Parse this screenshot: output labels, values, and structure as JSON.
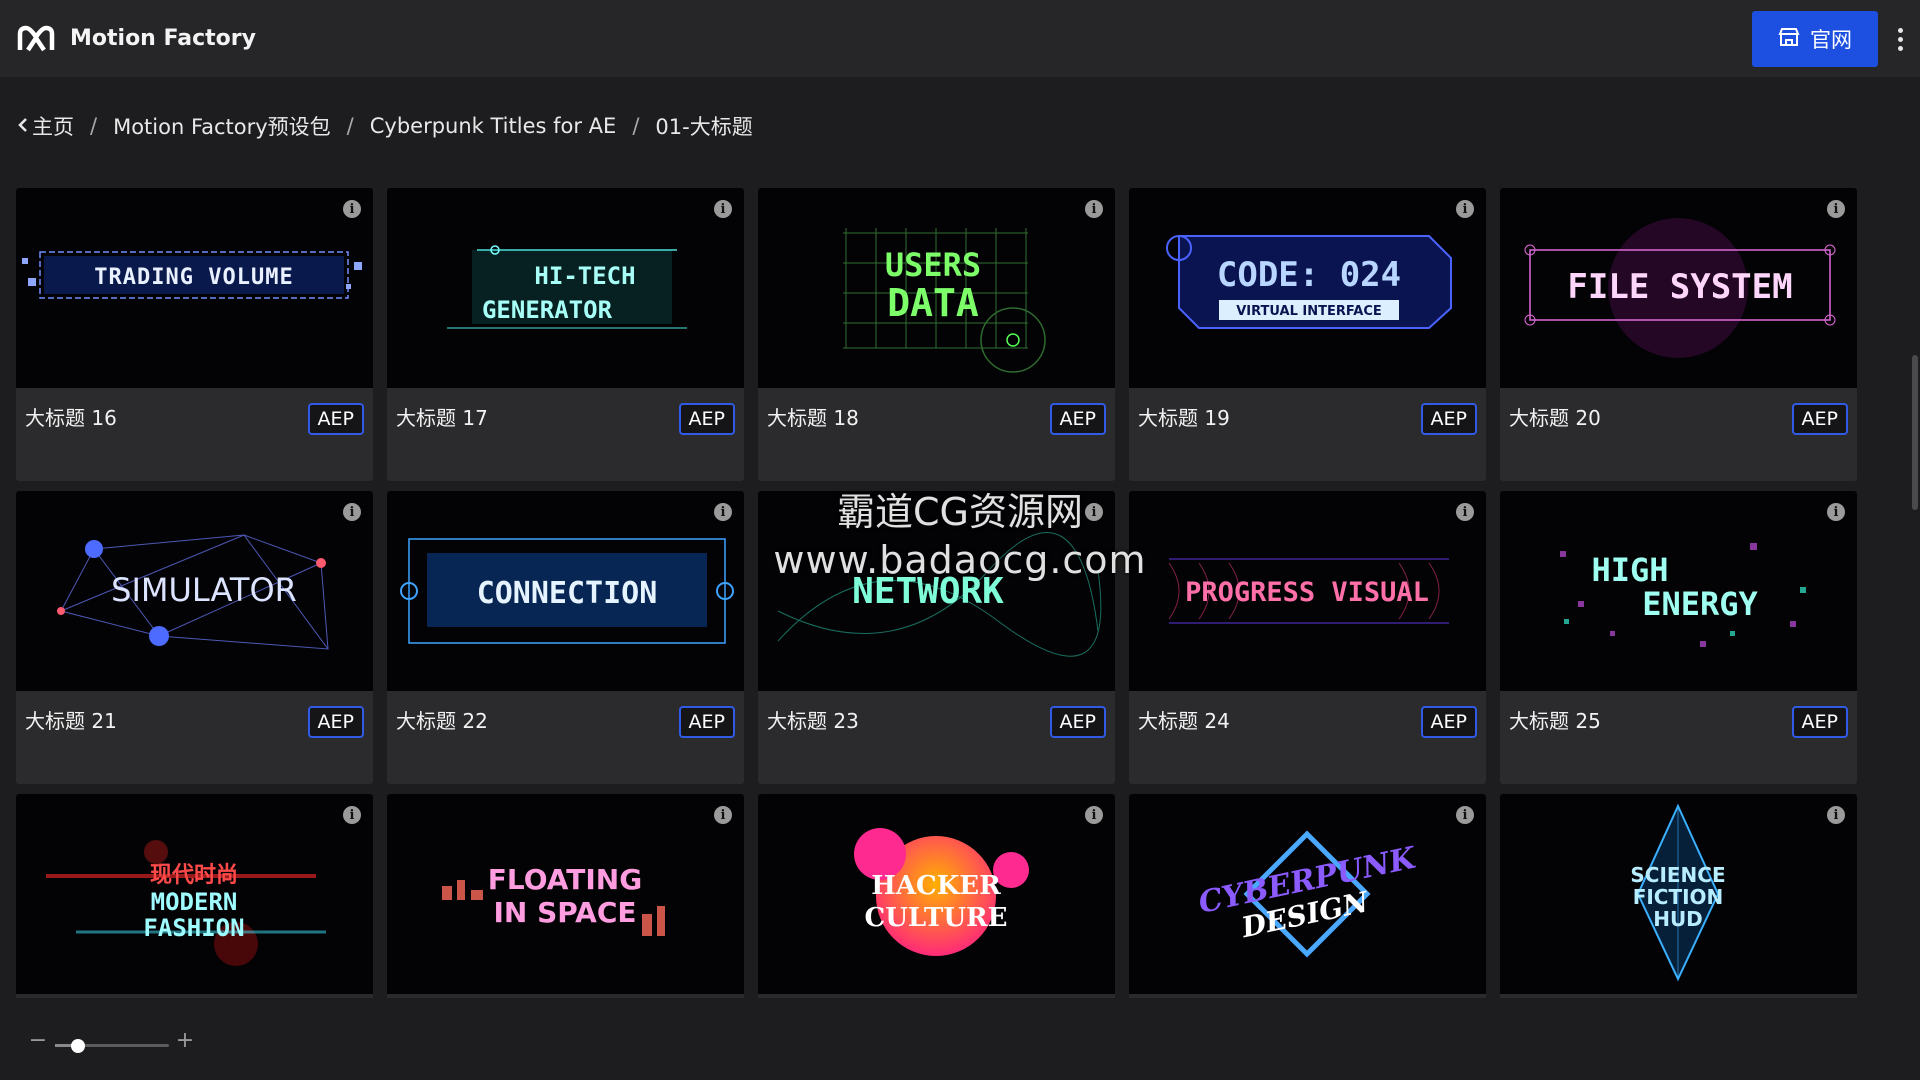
{
  "app": {
    "title": "Motion Factory",
    "site_button_label": "官网"
  },
  "breadcrumb": {
    "items": [
      "主页",
      "Motion Factory预设包",
      "Cyberpunk Titles for AE",
      "01-大标题"
    ],
    "separator": "/"
  },
  "cards": [
    {
      "title": "大标题 16",
      "badge": "AEP",
      "preview_text": "TRADING VOLUME"
    },
    {
      "title": "大标题 17",
      "badge": "AEP",
      "preview_text": [
        "HI-TECH",
        "GENERATOR"
      ]
    },
    {
      "title": "大标题 18",
      "badge": "AEP",
      "preview_text": [
        "USERS",
        "DATA"
      ]
    },
    {
      "title": "大标题 19",
      "badge": "AEP",
      "preview_text": [
        "CODE: 024",
        "VIRTUAL INTERFACE"
      ]
    },
    {
      "title": "大标题 20",
      "badge": "AEP",
      "preview_text": "FILE SYSTEM"
    },
    {
      "title": "大标题 21",
      "badge": "AEP",
      "preview_text": "SIMULATOR"
    },
    {
      "title": "大标题 22",
      "badge": "AEP",
      "preview_text": "CONNECTION"
    },
    {
      "title": "大标题 23",
      "badge": "AEP",
      "preview_text": "NETWORK"
    },
    {
      "title": "大标题 24",
      "badge": "AEP",
      "preview_text": "PROGRESS VISUAL"
    },
    {
      "title": "大标题 25",
      "badge": "AEP",
      "preview_text": [
        "HIGH",
        "ENERGY"
      ]
    },
    {
      "title": "",
      "badge": "",
      "preview_text": [
        "现代时尚",
        "MODERN",
        "FASHION"
      ]
    },
    {
      "title": "",
      "badge": "",
      "preview_text": [
        "FLOATING",
        "IN SPACE"
      ]
    },
    {
      "title": "",
      "badge": "",
      "preview_text": [
        "HACKER",
        "CULTURE"
      ]
    },
    {
      "title": "",
      "badge": "",
      "preview_text": [
        "CYBERPUNK",
        "DESIGN"
      ]
    },
    {
      "title": "",
      "badge": "",
      "preview_text": [
        "SCIENCE",
        "FICTION",
        "HUD"
      ]
    }
  ],
  "watermark": {
    "line1": "霸道CG资源网",
    "line2": "www.badaocg.com"
  },
  "zoom": {
    "minus": "−",
    "plus": "+",
    "level": 0.2
  },
  "colors": {
    "accent": "#1d4fe0",
    "background": "#1d1d1f",
    "card": "#2b2b2d",
    "badge_border": "#2f5be6"
  },
  "icons": {
    "logo": "motion-factory-logo-icon",
    "site": "storefront-icon",
    "more": "kebab-menu-icon",
    "back": "chevron-left-icon",
    "info": "info-icon"
  }
}
